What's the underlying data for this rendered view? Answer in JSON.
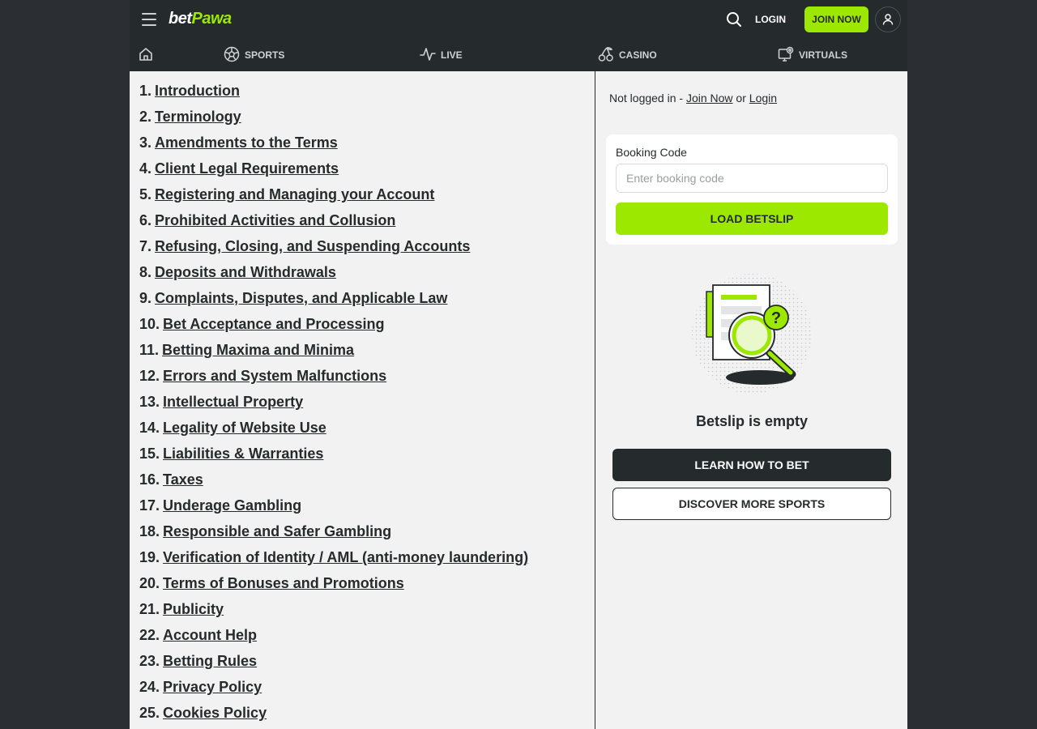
{
  "header": {
    "logo_bet": "bet",
    "logo_pawa": "Pawa",
    "login_label": "LOGIN",
    "join_label": "JOIN NOW",
    "icons": {
      "menu": "hamburger-menu-icon",
      "search": "search-icon",
      "user": "user-icon"
    }
  },
  "nav": {
    "sports": "SPORTS",
    "live": "LIVE",
    "casino": "CASINO",
    "virtuals": "VIRTUALS",
    "icons": {
      "home": "home-icon",
      "sports": "soccer-ball-icon",
      "live": "pulse-icon",
      "casino": "cherries-icon",
      "virtuals": "monitor-icon"
    }
  },
  "toc": [
    {
      "num": "1.",
      "label": "Introduction"
    },
    {
      "num": "2.",
      "label": "Terminology"
    },
    {
      "num": "3.",
      "label": "Amendments to the Terms"
    },
    {
      "num": "4.",
      "label": "Client Legal Requirements"
    },
    {
      "num": "5.",
      "label": "Registering and Managing your Account"
    },
    {
      "num": "6.",
      "label": "Prohibited Activities and Collusion"
    },
    {
      "num": "7.",
      "label": "Refusing, Closing, and Suspending Accounts"
    },
    {
      "num": "8.",
      "label": "Deposits and Withdrawals"
    },
    {
      "num": "9.",
      "label": "Complaints, Disputes, and Applicable Law"
    },
    {
      "num": "10.",
      "label": "Bet Acceptance and Processing"
    },
    {
      "num": "11.",
      "label": "Betting Maxima and Minima"
    },
    {
      "num": "12.",
      "label": "Errors and System Malfunctions"
    },
    {
      "num": "13.",
      "label": "Intellectual Property"
    },
    {
      "num": "14.",
      "label": "Legality of Website Use"
    },
    {
      "num": "15.",
      "label": "Liabilities & Warranties"
    },
    {
      "num": "16.",
      "label": "Taxes"
    },
    {
      "num": "17.",
      "label": "Underage Gambling"
    },
    {
      "num": "18.",
      "label": "Responsible and Safer Gambling"
    },
    {
      "num": "19.",
      "label": "Verification of Identity / AML (anti-money laundering)"
    },
    {
      "num": "20.",
      "label": "Terms of Bonuses and Promotions"
    },
    {
      "num": "21.",
      "label": "Publicity"
    },
    {
      "num": "22.",
      "label": "Account Help"
    },
    {
      "num": "23.",
      "label": "Betting Rules"
    },
    {
      "num": "24.",
      "label": "Privacy Policy"
    },
    {
      "num": "25.",
      "label": "Cookies Policy"
    }
  ],
  "sidebar": {
    "status_prefix": "Not logged in - ",
    "status_join": "Join Now",
    "status_or": " or ",
    "status_login": "Login",
    "booking_label": "Booking Code",
    "booking_placeholder": "Enter booking code",
    "load_label": "LOAD BETSLIP",
    "illustration_icon": "empty-betslip-magnifier-icon",
    "empty_title": "Betslip is empty",
    "learn_label": "LEARN HOW TO BET",
    "discover_label": "DISCOVER MORE SPORTS"
  },
  "colors": {
    "brand_green": "#9ce800",
    "dark": "#252a2d",
    "background": "#f2f2f2",
    "outer_background": "#2b2e33"
  }
}
